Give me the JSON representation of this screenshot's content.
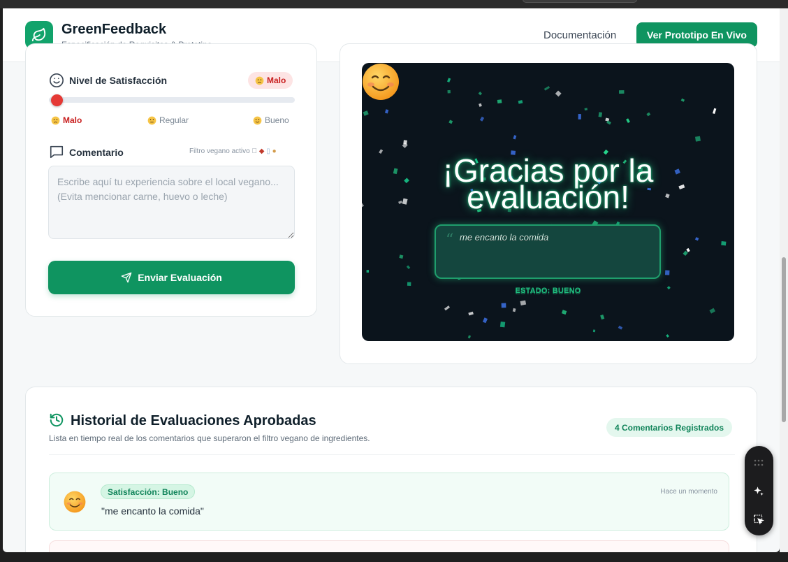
{
  "header": {
    "brand": "GreenFeedback",
    "subtitle": "Especificación de Requisitos & Prototipo",
    "doc_link": "Documentación",
    "live_button": "Ver Prototipo En Vivo"
  },
  "form": {
    "satisfaction_label": "Nivel de Satisfacción",
    "satisfaction_value": "Malo",
    "slider_level": 0,
    "ticks": [
      "Malo",
      "Regular",
      "Bueno"
    ],
    "comment_label": "Comentario",
    "filter_note": "Filtro vegano activo",
    "comment_placeholder": "Escribe aquí tu experiencia sobre el local vegano... (Evita mencionar carne, huevo o leche)",
    "submit_label": "Enviar Evaluación"
  },
  "preview": {
    "thanks": "¡Gracias por la evaluación!",
    "quote": "me encanto la comida",
    "status": "ESTADO: BUENO"
  },
  "history": {
    "title": "Historial de Evaluaciones Aprobadas",
    "subtitle": "Lista en tiempo real de los comentarios que superaron el filtro vegano de ingredientes.",
    "count_badge": "4 Comentarios Registrados",
    "entries": [
      {
        "badge": "Satisfacción: Bueno",
        "text": "\"me encanto la comida\"",
        "time": "Hace un momento"
      }
    ]
  },
  "colors": {
    "primary": "#0f9460",
    "danger": "#e53935",
    "preview_bg": "#0b141c"
  }
}
